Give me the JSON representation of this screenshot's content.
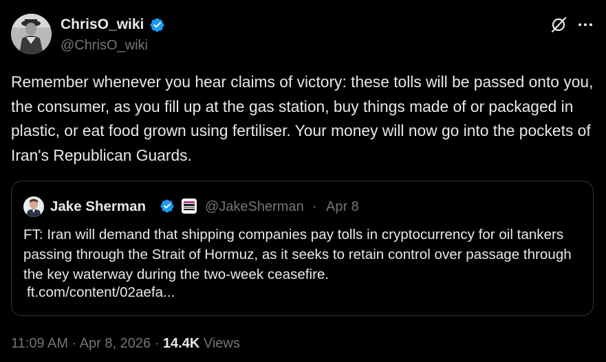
{
  "author": {
    "display_name": "ChrisO_wiki",
    "handle": "@ChrisO_wiki",
    "verified": true
  },
  "header_icons": [
    "grok-icon",
    "more-icon"
  ],
  "tweet": {
    "text": "Remember whenever you hear claims of victory: these tolls will be passed onto you, the consumer, as you fill up at the gas station, buy things made of or packaged in plastic, or eat food grown using fertiliser. Your money will now go into the pockets of Iran's Republican Guards."
  },
  "quote": {
    "display_name": "Jake Sherman",
    "handle": "@JakeSherman",
    "separator": "·",
    "date": "Apr 8",
    "verified": true,
    "text": "FT: Iran will demand that shipping companies pay tolls in cryptocurrency for oil tankers passing through the Strait of Hormuz, as it seeks to retain control over passage through the key waterway during the two-week ceasefire.",
    "link": "ft.com/content/02aefa..."
  },
  "meta": {
    "time": "11:09 AM",
    "sep1": " · ",
    "date": "Apr 8, 2026",
    "sep2": " · ",
    "views_count": "14.4K",
    "views_label": " Views"
  },
  "colors": {
    "background": "#000000",
    "text_primary": "#e7e9ea",
    "text_secondary": "#71767b",
    "verified_blue": "#1d9bf0",
    "card_border": "#333639"
  }
}
